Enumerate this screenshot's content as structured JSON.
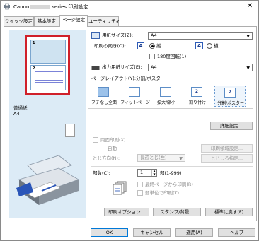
{
  "window": {
    "title_prefix": "Canon",
    "title_suffix": "series 印刷設定",
    "close_symbol": "✕"
  },
  "tabs": [
    {
      "label": "クイック設定"
    },
    {
      "label": "基本設定"
    },
    {
      "label": "ページ設定",
      "active": true
    },
    {
      "label": "ユーティリティ"
    }
  ],
  "preview": {
    "page1_num": "1",
    "page2_num": "2",
    "media_type": "普通紙",
    "media_size": "A4"
  },
  "page_setup": {
    "paper_size_label": "用紙サイズ(Z):",
    "paper_size_value": "A4",
    "orientation_label": "印刷の向き(O):",
    "portrait_label": "縦",
    "landscape_label": "横",
    "rotate180_label": "180度回転(1)",
    "output_size_label": "出力用紙サイズ(E):",
    "output_size_value": "A4",
    "layout_section_label": "ページレイアウト(Y):分割/ポスター",
    "layouts": [
      {
        "label": "フチなし全面"
      },
      {
        "label": "フィットページ"
      },
      {
        "label": "拡大/縮小"
      },
      {
        "label": "割り付け",
        "num": "2"
      },
      {
        "label": "分割/ポスター",
        "num": "2"
      }
    ],
    "detail_button": "詳細設定...",
    "duplex_label": "両面印刷(X)",
    "auto_label": "自動",
    "print_area_button": "印刷領域設定...",
    "binding_label": "とじ方向(N):",
    "binding_value": "長辺とじ(左)",
    "binding_margin_button": "とじしろ指定...",
    "copies_label": "部数(C):",
    "copies_value": "1",
    "copies_range": "部(1-999)",
    "last_page_first_label": "最終ページから印刷(R)",
    "collate_label": "部単位で印刷(T)",
    "print_options_button": "印刷オプション...",
    "stamp_button": "スタンプ/背景...",
    "defaults_button": "標準に戻す(F)"
  },
  "footer": {
    "ok": "OK",
    "cancel": "キャンセル",
    "apply": "適用(A)",
    "help": "ヘルプ"
  },
  "colors": {
    "preview_bg": "#dcebf6",
    "preview_border": "#d0202a",
    "accent": "#0078d7"
  }
}
